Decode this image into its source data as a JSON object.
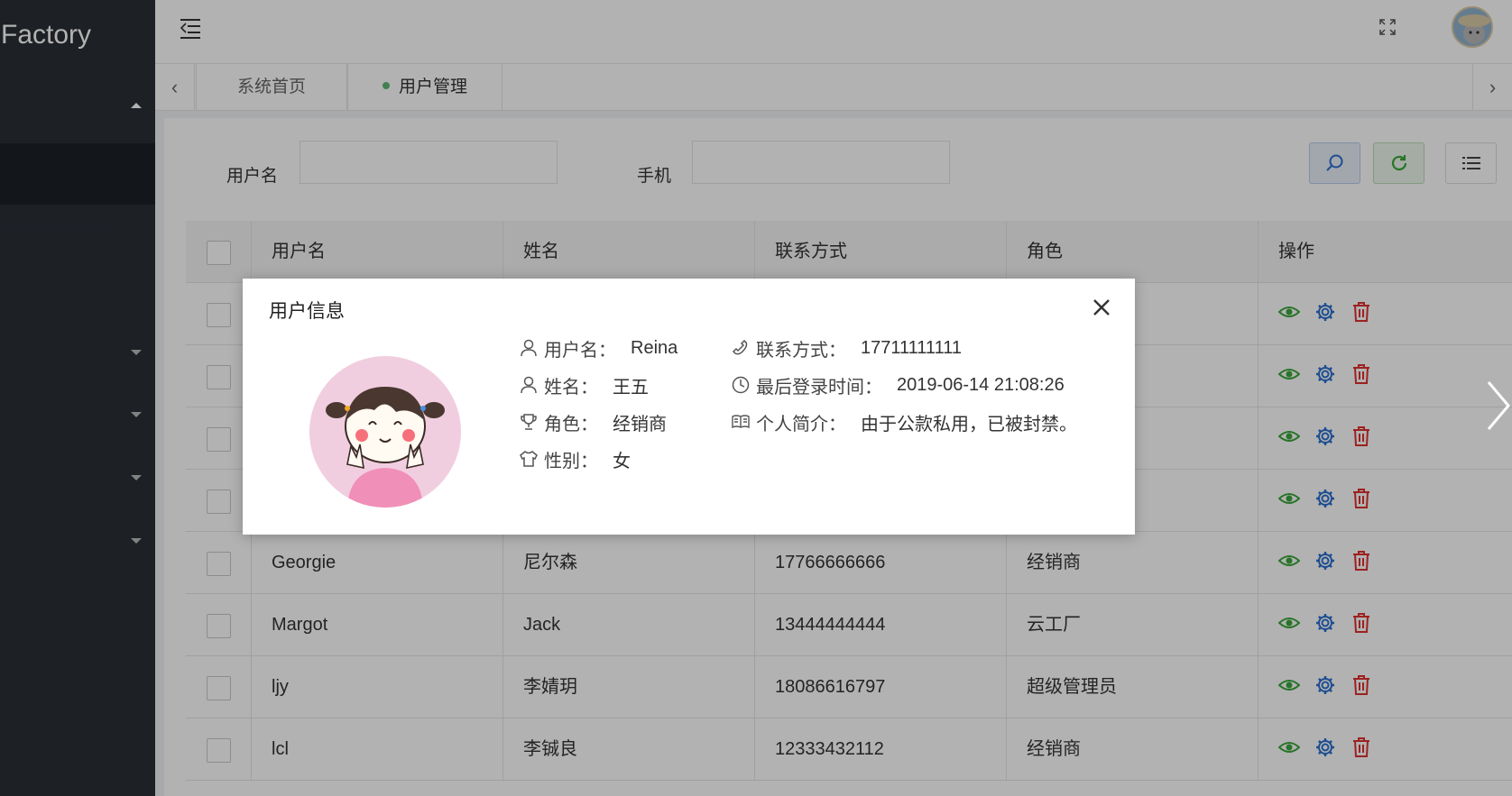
{
  "sidebar": {
    "brand": "l Factory"
  },
  "tabs": {
    "home": "系统首页",
    "users": "用户管理"
  },
  "search": {
    "username_label": "用户名",
    "phone_label": "手机",
    "username_value": "",
    "phone_value": ""
  },
  "table": {
    "headers": {
      "username": "用户名",
      "name": "姓名",
      "contact": "联系方式",
      "role": "角色",
      "ops": "操作"
    },
    "rows": [
      {
        "username": "",
        "name": "",
        "contact": "",
        "role": ""
      },
      {
        "username": "",
        "name": "",
        "contact": "",
        "role": ""
      },
      {
        "username": "",
        "name": "",
        "contact": "",
        "role": ""
      },
      {
        "username": "",
        "name": "",
        "contact": "",
        "role": ""
      },
      {
        "username": "Georgie",
        "name": "尼尔森",
        "contact": "17766666666",
        "role": "经销商"
      },
      {
        "username": "Margot",
        "name": "Jack",
        "contact": "13444444444",
        "role": "云工厂"
      },
      {
        "username": "ljy",
        "name": "李婧玥",
        "contact": "18086616797",
        "role": "超级管理员"
      },
      {
        "username": "lcl",
        "name": "李铖良",
        "contact": "12333432112",
        "role": "经销商"
      }
    ]
  },
  "modal": {
    "title": "用户信息",
    "username_label": "用户名：",
    "username": "Reina",
    "name_label": "姓名：",
    "name": "王五",
    "role_label": "角色：",
    "role": "经销商",
    "gender_label": "性别：",
    "gender": "女",
    "contact_label": "联系方式：",
    "contact": "17711111111",
    "last_login_label": "最后登录时间：",
    "last_login": "2019-06-14 21:08:26",
    "bio_label": "个人简介：",
    "bio": "由于公款私用，已被封禁。"
  },
  "colors": {
    "view": "#3aa63a",
    "settings": "#2a6fd0",
    "delete": "#e0302f",
    "sidebar": "#2a2f36"
  }
}
